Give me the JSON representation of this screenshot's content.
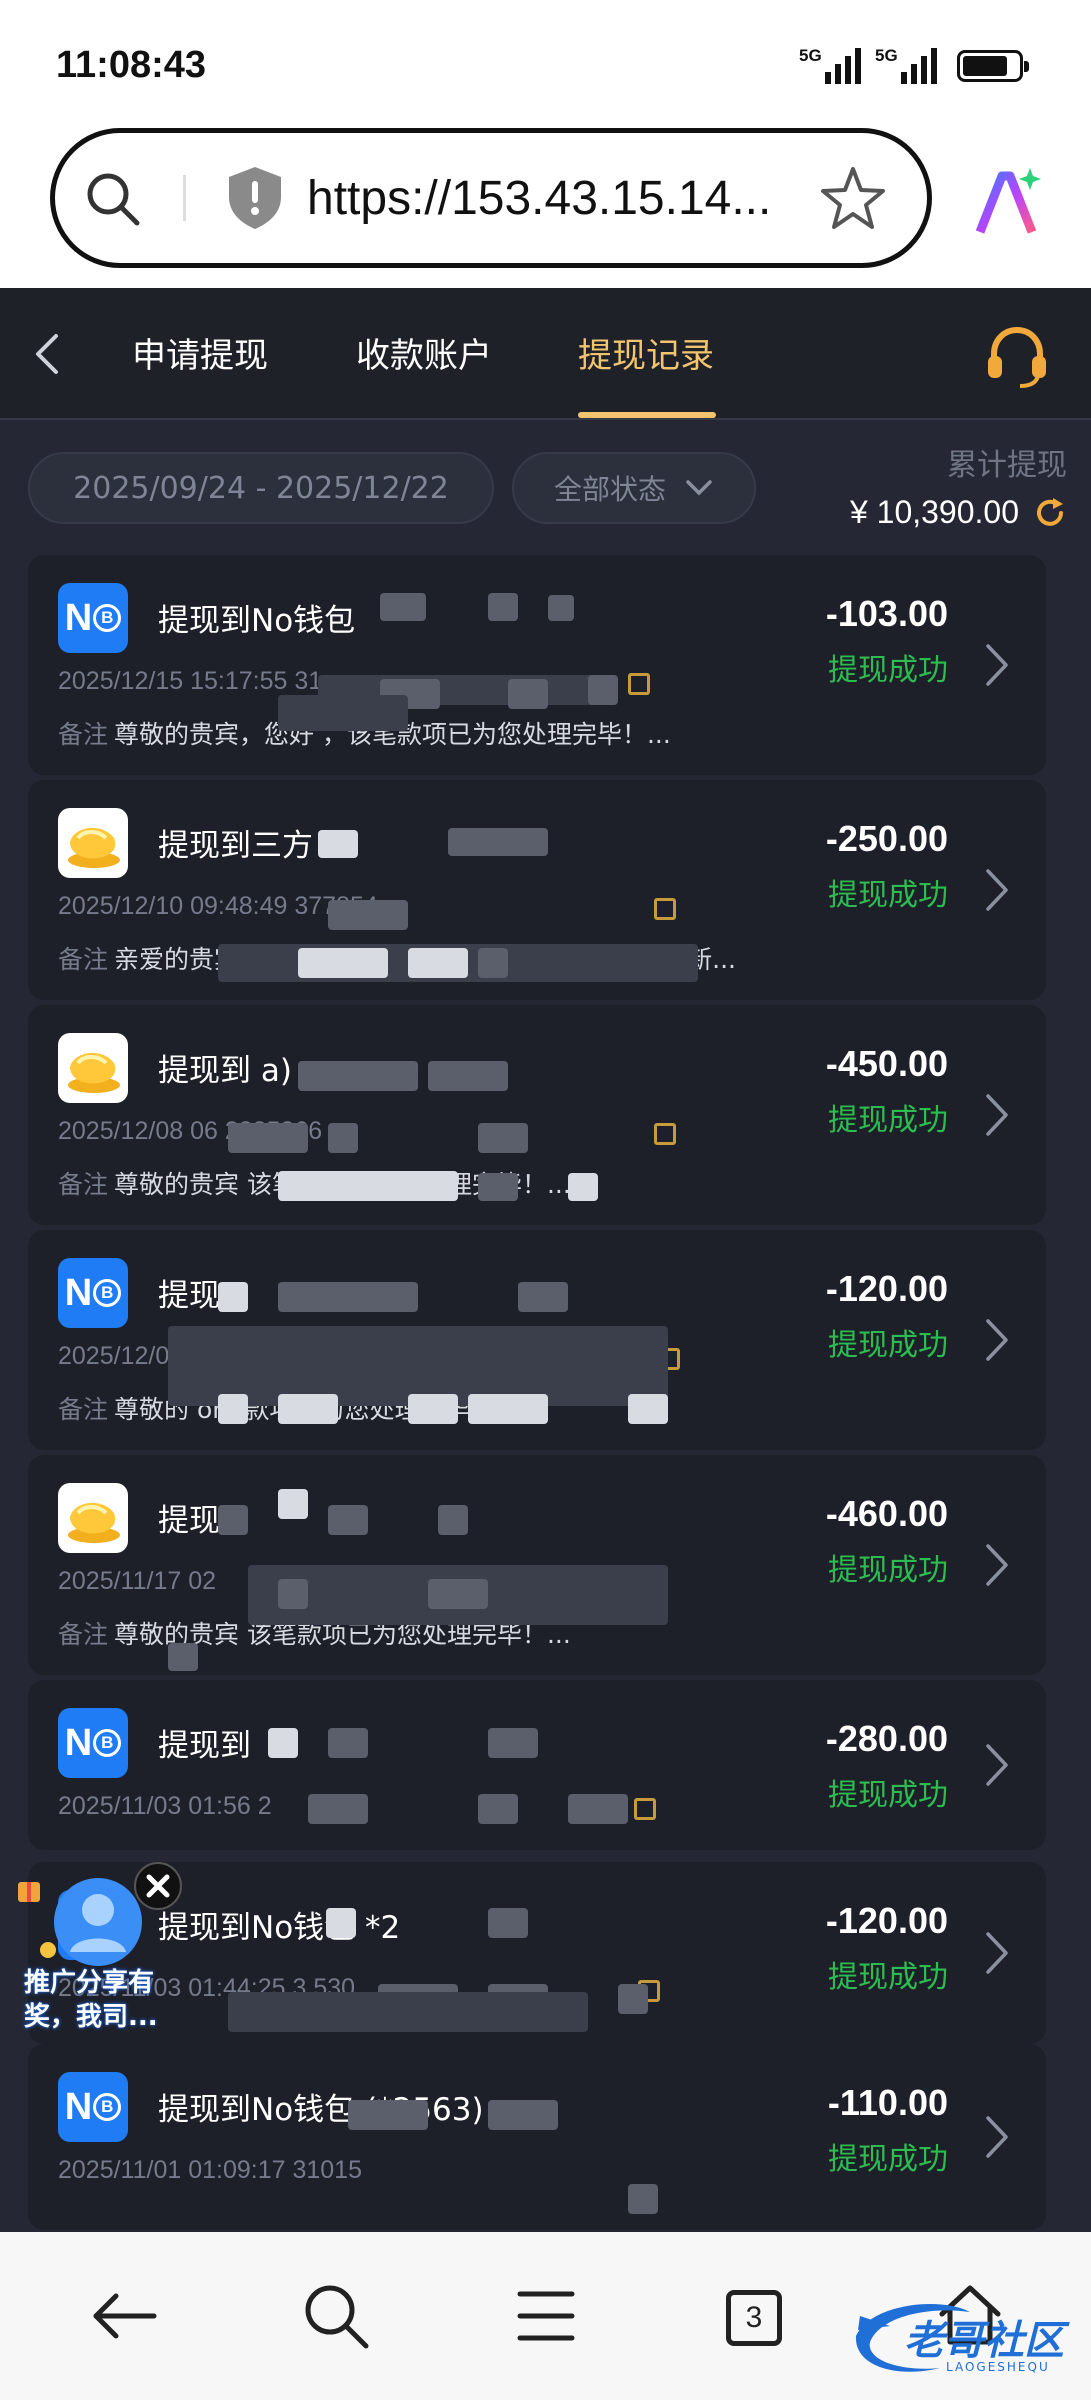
{
  "status_bar": {
    "time": "11:08:43",
    "signal1": "5G",
    "signal2": "5G"
  },
  "browser": {
    "url": "https://153.43.15.14..."
  },
  "nav": {
    "tabs": [
      {
        "label": "申请提现"
      },
      {
        "label": "收款账户"
      },
      {
        "label": "提现记录",
        "active": true
      }
    ]
  },
  "filters": {
    "date_range": "2025/09/24 - 2025/12/22",
    "status_select": "全部状态",
    "total_label": "累计提现",
    "total_value": "¥ 10,390.00"
  },
  "records": [
    {
      "icon": "nb-wallet-icon",
      "title": "提现到No钱包",
      "meta": "2025/12/15 15:17:55  31",
      "note_label": "备注",
      "note": "尊敬的贵宾，您好                              ，该笔款项已为您处理完毕！...",
      "amount": "-103.00",
      "status": "提现成功"
    },
    {
      "icon": "gold-coin-icon",
      "title": "提现到三方",
      "meta": "2025/12/10 09:48:49                     377854",
      "note_label": "备注",
      "note": "亲爱的贵宾，您                       2.com，查询您的游戏账号已符合“新...",
      "amount": "-250.00",
      "status": "提现成功"
    },
    {
      "icon": "gold-coin-icon",
      "title": "提现到                        a)",
      "meta": "2025/12/08 06                        2885366",
      "note_label": "备注",
      "note": "尊敬的贵宾                                  该笔款项已为您处理完毕！...",
      "amount": "-450.00",
      "status": "提现成功"
    },
    {
      "icon": "nb-wallet-icon",
      "title": "提现",
      "meta": "2025/12/04                                 523",
      "note_label": "备注",
      "note": "尊敬的                                   om        款项已为您处理完毕！...",
      "amount": "-120.00",
      "status": "提现成功"
    },
    {
      "icon": "gold-coin-icon",
      "title": "提现",
      "meta": "2025/11/17 02",
      "note_label": "备注",
      "note": "尊敬的贵宾                                  该笔款项已为您处理完毕！...",
      "amount": "-460.00",
      "status": "提现成功"
    },
    {
      "icon": "nb-wallet-icon",
      "title": "提现到",
      "meta": "2025/11/03 01:56                 2",
      "note_label": "",
      "note": "",
      "amount": "-280.00",
      "status": "提现成功"
    },
    {
      "icon": "nb-wallet-icon",
      "title": "提现到No钱包          *2",
      "meta": "2025/11/03 01:44:25  3              530",
      "note_label": "",
      "note": "",
      "amount": "-120.00",
      "status": "提现成功"
    },
    {
      "icon": "nb-wallet-icon",
      "title": "提现到No钱包      (*2563)",
      "meta": "2025/11/01 01:09:17  31015",
      "note_label": "",
      "note": "",
      "amount": "-110.00",
      "status": "提现成功"
    }
  ],
  "promo": {
    "text_line1": "推广分享有",
    "text_line2": "奖，我司..."
  },
  "bottom_bar": {
    "tab_count": "3"
  },
  "watermark": {
    "text": "老哥社区",
    "subtext": "LAOGESHEQU"
  },
  "colors": {
    "accent": "#f2c46d",
    "success": "#2bbd4f",
    "background": "#252834",
    "card": "#1e2029"
  }
}
